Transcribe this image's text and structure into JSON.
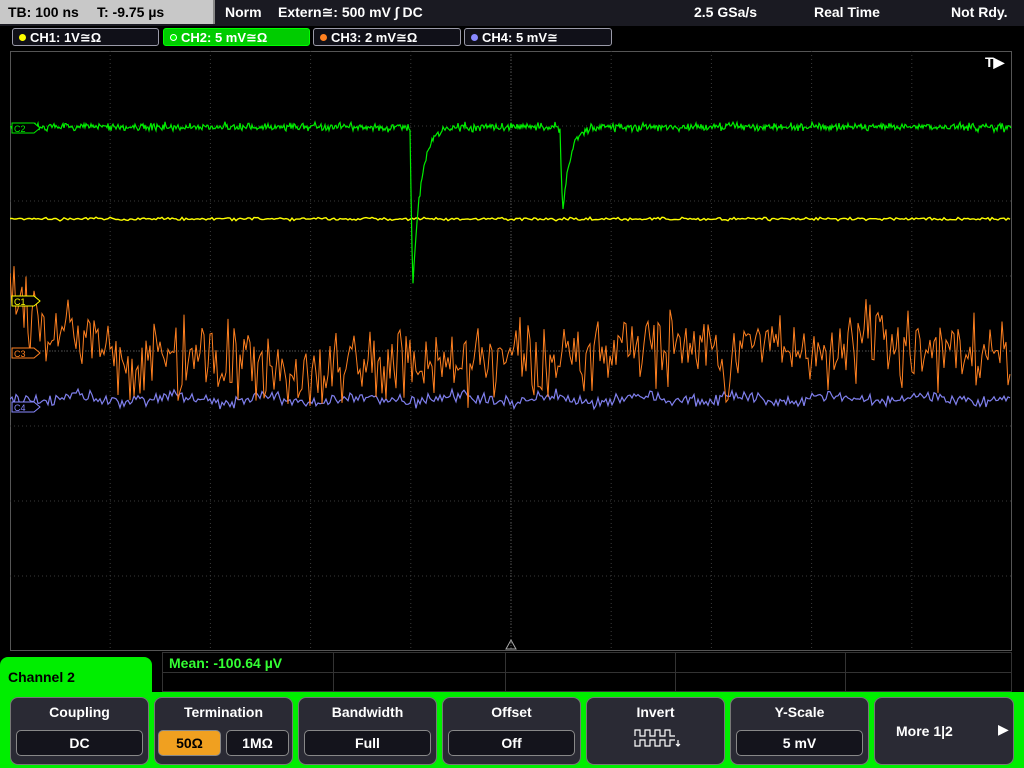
{
  "status_bar": {
    "timebase": "TB: 100 ns",
    "trigger_time": "T: -9.75 µs",
    "trigger_mode": "Norm",
    "trigger_source": "Extern≅: 500 mV ∫ DC",
    "sample_rate": "2.5 GSa/s",
    "acq_mode": "Real Time",
    "ready_status": "Not Rdy."
  },
  "channels": [
    {
      "label": "CH1: 1V≅Ω",
      "color": "#ffff00"
    },
    {
      "label": "CH2: 5 mV≅Ω",
      "color": "#00ff00"
    },
    {
      "label": "CH3: 2 mV≅Ω",
      "color": "#ff8020"
    },
    {
      "label": "CH4: 5 mV≅",
      "color": "#8888ff"
    }
  ],
  "markers": {
    "c1": "C1",
    "c2": "C2",
    "c3": "C3",
    "c4": "C4",
    "trigger": "T▶"
  },
  "measurement": {
    "mean": "Mean: -100.64 µV"
  },
  "menu": {
    "title": "Channel 2",
    "coupling_label": "Coupling",
    "coupling_value": "DC",
    "termination_label": "Termination",
    "term_50": "50Ω",
    "term_1m": "1MΩ",
    "bandwidth_label": "Bandwidth",
    "bandwidth_value": "Full",
    "offset_label": "Offset",
    "offset_value": "Off",
    "invert_label": "Invert",
    "invert_icon": "square-wave-icon",
    "yscale_label": "Y-Scale",
    "yscale_value": "5 mV",
    "more_label": "More 1|2"
  },
  "colors": {
    "ch1": "#ffff00",
    "ch2": "#00ff00",
    "ch3": "#ff8020",
    "ch4": "#8888ff",
    "menu_green": "#00ee00",
    "active_termination": "#f0a020"
  }
}
